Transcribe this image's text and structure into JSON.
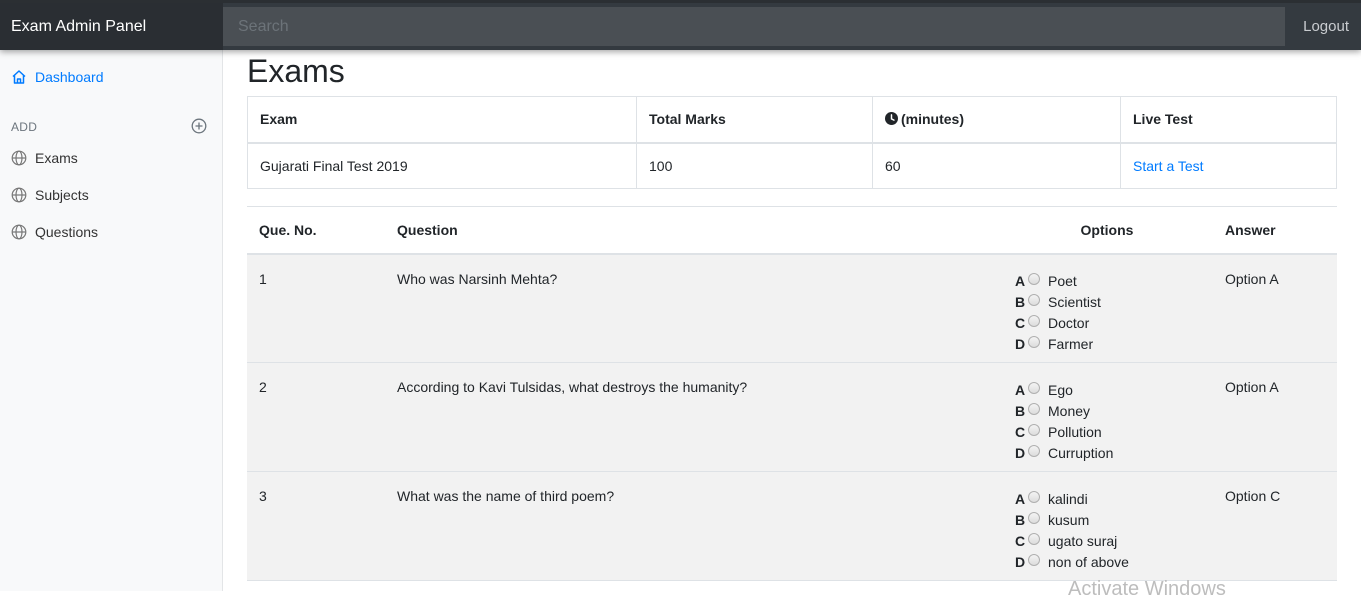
{
  "navbar": {
    "brand": "Exam Admin Panel",
    "search_placeholder": "Search",
    "logout_label": "Logout"
  },
  "sidebar": {
    "dashboard_label": "Dashboard",
    "add_heading": "ADD",
    "items": [
      {
        "label": "Exams",
        "icon": "globe-icon"
      },
      {
        "label": "Subjects",
        "icon": "globe-icon"
      },
      {
        "label": "Questions",
        "icon": "globe-icon"
      }
    ]
  },
  "main": {
    "title": "Exams",
    "exam_table": {
      "headers": [
        "Exam",
        "Total Marks",
        "(minutes)",
        "Live Test"
      ],
      "row": {
        "exam": "Gujarati Final Test 2019",
        "total_marks": "100",
        "minutes": "60",
        "live_test_link": "Start a Test"
      }
    },
    "question_table": {
      "headers": [
        "Que. No.",
        "Question",
        "Options",
        "Answer"
      ],
      "rows": [
        {
          "no": "1",
          "question": "Who was Narsinh Mehta?",
          "options": [
            {
              "letter": "A",
              "text": "Poet"
            },
            {
              "letter": "B",
              "text": "Scientist"
            },
            {
              "letter": "C",
              "text": "Doctor"
            },
            {
              "letter": "D",
              "text": "Farmer"
            }
          ],
          "answer": "Option A"
        },
        {
          "no": "2",
          "question": "According to Kavi Tulsidas, what destroys the humanity?",
          "options": [
            {
              "letter": "A",
              "text": "Ego"
            },
            {
              "letter": "B",
              "text": "Money"
            },
            {
              "letter": "C",
              "text": "Pollution"
            },
            {
              "letter": "D",
              "text": "Curruption"
            }
          ],
          "answer": "Option A"
        },
        {
          "no": "3",
          "question": "What was the name of third poem?",
          "options": [
            {
              "letter": "A",
              "text": "kalindi"
            },
            {
              "letter": "B",
              "text": "kusum"
            },
            {
              "letter": "C",
              "text": "ugato suraj"
            },
            {
              "letter": "D",
              "text": "non of above"
            }
          ],
          "answer": "Option C"
        }
      ]
    }
  },
  "watermark": "Activate Windows",
  "colors": {
    "navbar": "#343a40",
    "brand_bg": "#2a2e33",
    "accent": "#007bff",
    "sidebar_bg": "#f8f9fa",
    "row_stripe": "#f2f2f2"
  }
}
